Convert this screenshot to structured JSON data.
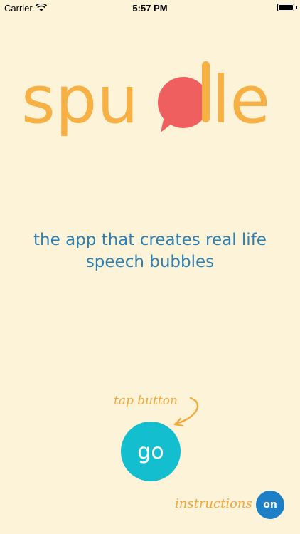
{
  "status_bar": {
    "carrier": "Carrier",
    "time": "5:57 PM"
  },
  "logo": {
    "text_left": "spu",
    "text_right": "le",
    "brand_color": "#f6b043",
    "bubble_color": "#f05f5f"
  },
  "tagline": {
    "line1": "the app that creates real life",
    "line2": "speech bubbles"
  },
  "go": {
    "hint": "tap button",
    "label": "go"
  },
  "instructions": {
    "label": "instructions",
    "toggle_label": "on"
  },
  "colors": {
    "background": "#fdf3d8",
    "tagline": "#2f7fb0",
    "go_button": "#13bfcf",
    "toggle": "#1d7fc6",
    "accent": "#f2a93b"
  }
}
